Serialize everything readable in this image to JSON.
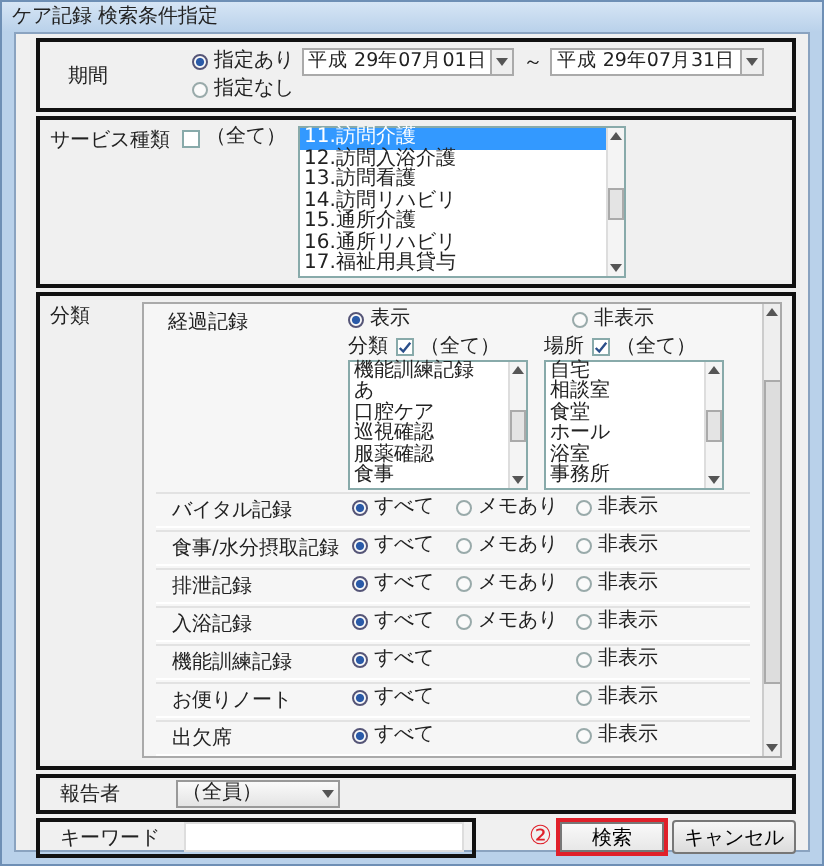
{
  "window": {
    "title": "ケア記録 検索条件指定"
  },
  "period": {
    "label": "期間",
    "options": [
      {
        "label": "指定あり",
        "selected": true
      },
      {
        "label": "指定なし",
        "selected": false
      }
    ],
    "from": "平成 29年07月01日",
    "separator": "～",
    "to": "平成 29年07月31日"
  },
  "service": {
    "label": "サービス種類",
    "all": {
      "label": "（全て）",
      "checked": false
    },
    "items": [
      {
        "label": "11.訪問介護",
        "selected": true
      },
      {
        "label": "12.訪問入浴介護",
        "selected": false
      },
      {
        "label": "13.訪問看護",
        "selected": false
      },
      {
        "label": "14.訪問リハビリ",
        "selected": false
      },
      {
        "label": "15.通所介護",
        "selected": false
      },
      {
        "label": "16.通所リハビリ",
        "selected": false
      },
      {
        "label": "17.福祉用具貸与",
        "selected": false
      }
    ]
  },
  "classification": {
    "label": "分類",
    "progress": {
      "label": "経過記録",
      "options": [
        {
          "label": "表示",
          "selected": true
        },
        {
          "label": "非表示",
          "selected": false
        }
      ],
      "lists": [
        {
          "label": "分類",
          "all": {
            "label": "（全て）",
            "checked": true
          },
          "items": [
            "機能訓練記録",
            "あ",
            "口腔ケア",
            "巡視確認",
            "服薬確認",
            "食事"
          ]
        },
        {
          "label": "場所",
          "all": {
            "label": "（全て）",
            "checked": true
          },
          "items": [
            "自宅",
            "相談室",
            "食堂",
            "ホール",
            "浴室",
            "事務所"
          ]
        }
      ]
    },
    "records": [
      {
        "label": "バイタル記録",
        "options": [
          {
            "label": "すべて",
            "selected": true
          },
          {
            "label": "メモあり",
            "selected": false
          },
          {
            "label": "非表示",
            "selected": false
          }
        ]
      },
      {
        "label": "食事/水分摂取記録",
        "options": [
          {
            "label": "すべて",
            "selected": true
          },
          {
            "label": "メモあり",
            "selected": false
          },
          {
            "label": "非表示",
            "selected": false
          }
        ]
      },
      {
        "label": "排泄記録",
        "options": [
          {
            "label": "すべて",
            "selected": true
          },
          {
            "label": "メモあり",
            "selected": false
          },
          {
            "label": "非表示",
            "selected": false
          }
        ]
      },
      {
        "label": "入浴記録",
        "options": [
          {
            "label": "すべて",
            "selected": true
          },
          {
            "label": "メモあり",
            "selected": false
          },
          {
            "label": "非表示",
            "selected": false
          }
        ]
      },
      {
        "label": "機能訓練記録",
        "options": [
          {
            "label": "すべて",
            "selected": true
          },
          {
            "label": "非表示",
            "selected": false
          }
        ]
      },
      {
        "label": "お便りノート",
        "options": [
          {
            "label": "すべて",
            "selected": true
          },
          {
            "label": "非表示",
            "selected": false
          }
        ]
      },
      {
        "label": "出欠席",
        "options": [
          {
            "label": "すべて",
            "selected": true
          },
          {
            "label": "非表示",
            "selected": false
          }
        ]
      }
    ]
  },
  "reporter": {
    "label": "報告者",
    "value": "（全員）"
  },
  "keyword": {
    "label": "キーワード"
  },
  "buttons": [
    {
      "label": "検索",
      "highlighted": true,
      "marker": "②"
    },
    {
      "label": "キャンセル",
      "highlighted": false
    }
  ]
}
